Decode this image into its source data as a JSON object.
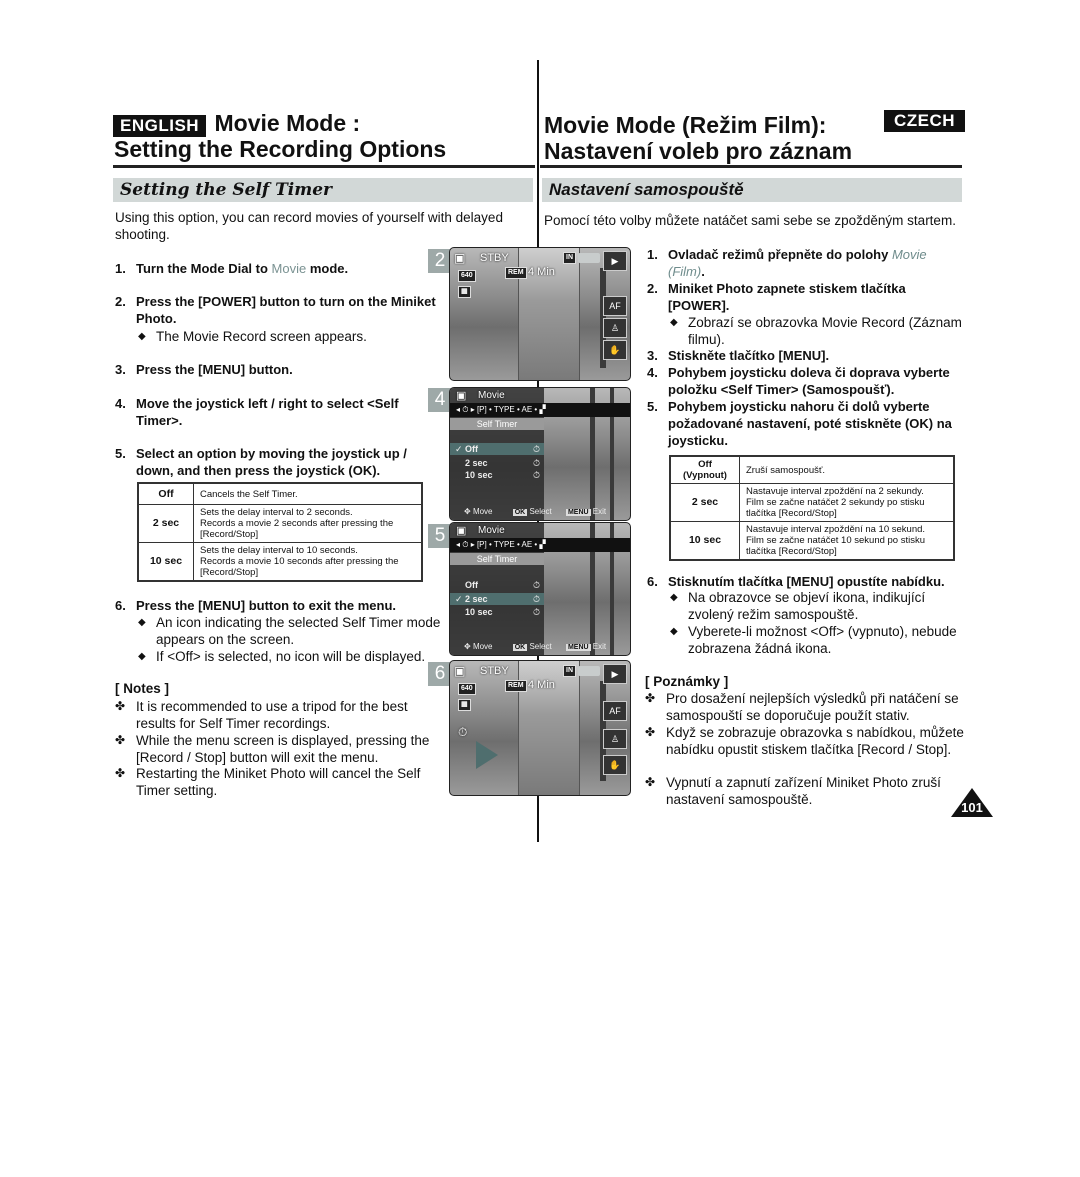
{
  "english": {
    "lang_badge": "ENGLISH",
    "title_line1": "Movie Mode :",
    "title_line2": "Setting the Recording Options",
    "section": "Setting the Self Timer",
    "intro": "Using this option, you can record movies of yourself with delayed shooting.",
    "steps": [
      {
        "num": "1.",
        "before": "Turn the Mode Dial to ",
        "accent": "Movie",
        "after": " mode."
      },
      {
        "num": "2.",
        "text": "Press the [POWER] button to turn on the Miniket Photo.",
        "sub": "The Movie Record screen appears."
      },
      {
        "num": "3.",
        "text": "Press the [MENU] button."
      },
      {
        "num": "4.",
        "text": "Move the joystick left / right to select <Self Timer>."
      },
      {
        "num": "5.",
        "text": "Select an option by moving the joystick up / down, and then press the joystick (OK)."
      },
      {
        "num": "6.",
        "text": "Press the [MENU] button to exit the menu.",
        "subs": [
          "An icon indicating the selected Self Timer mode appears on the screen.",
          "If <Off> is selected, no icon will be displayed."
        ]
      }
    ],
    "table": [
      {
        "key": "Off",
        "desc": [
          "Cancels the Self Timer."
        ]
      },
      {
        "key": "2 sec",
        "desc": [
          "Sets the delay interval to 2 seconds.",
          "Records a movie 2 seconds after pressing the [Record/Stop]"
        ]
      },
      {
        "key": "10 sec",
        "desc": [
          "Sets the delay interval to 10 seconds.",
          "Records a movie 10 seconds after pressing the [Record/Stop]"
        ]
      }
    ],
    "notes_heading": "[ Notes ]",
    "notes": [
      "It is recommended to use a tripod for the best results for Self Timer recordings.",
      "While the menu screen is displayed, pressing the [Record / Stop] button will exit the menu.",
      "Restarting the Miniket Photo will cancel the Self Timer setting."
    ]
  },
  "czech": {
    "lang_badge": "CZECH",
    "title_line1": "Movie Mode (Režim Film):",
    "title_line2": "Nastavení voleb pro záznam",
    "section": "Nastavení samospouště",
    "intro": "Pomocí této volby můžete natáčet sami sebe se zpožděným startem.",
    "steps": [
      {
        "num": "1.",
        "before": "Ovladač režimů přepněte do polohy ",
        "accent": "Movie (Film)",
        "after": "."
      },
      {
        "num": "2.",
        "text": "Miniket Photo zapnete stiskem tlačítka [POWER].",
        "sub": "Zobrazí se obrazovka Movie Record (Záznam filmu)."
      },
      {
        "num": "3.",
        "text": "Stiskněte tlačítko [MENU]."
      },
      {
        "num": "4.",
        "text": "Pohybem joysticku doleva či doprava vyberte položku <Self Timer> (Samospoušť)."
      },
      {
        "num": "5.",
        "text": "Pohybem joysticku nahoru či dolů vyberte požadované nastavení, poté stiskněte (OK) na joysticku."
      },
      {
        "num": "6.",
        "text": "Stisknutím tlačítka [MENU] opustíte nabídku.",
        "subs": [
          "Na obrazovce se objeví ikona, indikující zvolený režim samospouště.",
          "Vyberete-li možnost <Off> (vypnuto), nebude zobrazena žádná ikona."
        ]
      }
    ],
    "table": [
      {
        "key": "Off (Vypnout)",
        "desc": [
          "Zruší samospoušť."
        ]
      },
      {
        "key": "2 sec",
        "desc": [
          "Nastavuje interval zpoždění na 2 sekundy.",
          "Film se začne natáčet 2 sekundy po stisku tlačítka [Record/Stop]"
        ]
      },
      {
        "key": "10 sec",
        "desc": [
          "Nastavuje interval zpoždění na 10 sekund.",
          "Film se začne natáčet 10 sekund po stisku tlačítka [Record/Stop]"
        ]
      }
    ],
    "notes_heading": "[ Poznámky ]",
    "notes": [
      "Pro dosažení nejlepších výsledků při natáčení se samospouští se doporučuje použít stativ.",
      "Když se zobrazuje obrazovka s nabídkou, můžete nabídku opustit stiskem tlačítka [Record / Stop].",
      "Vypnutí a zapnutí zařízení Miniket Photo zruší nastavení samospouště."
    ]
  },
  "screens": [
    {
      "step": "2",
      "status": "STBY",
      "rem": "REM",
      "time": "4 Min",
      "res": "640",
      "in": "IN"
    },
    {
      "step": "4",
      "mode": "Movie",
      "menu_title": "Self Timer",
      "options": [
        "Off",
        "2 sec",
        "10 sec"
      ],
      "selected": 0,
      "footer": {
        "move": "Move",
        "ok_key": "OK",
        "ok": "Select",
        "menu_key": "MENU",
        "menu": "Exit"
      },
      "bar": "◂  ⏱  ▸ [P] • TYPE • AE • ▞"
    },
    {
      "step": "5",
      "mode": "Movie",
      "menu_title": "Self Timer",
      "options": [
        "Off",
        "2 sec",
        "10 sec"
      ],
      "selected": 1,
      "footer": {
        "move": "Move",
        "ok_key": "OK",
        "ok": "Select",
        "menu_key": "MENU",
        "menu": "Exit"
      },
      "bar": "◂  ⏱  ▸ [P] • TYPE • AE • ▞"
    },
    {
      "step": "6",
      "status": "STBY",
      "rem": "REM",
      "time": "4 Min",
      "res": "640",
      "in": "IN"
    }
  ],
  "page_number": "101",
  "colors": {
    "accent": "#7a9292",
    "section_bar": "#d2d8d7",
    "step_box": "#9ea9a8"
  },
  "icons": {
    "diamond": "◆",
    "clover": "✤",
    "check": "✓",
    "camcorder": "🎥",
    "timer": "⏱"
  }
}
